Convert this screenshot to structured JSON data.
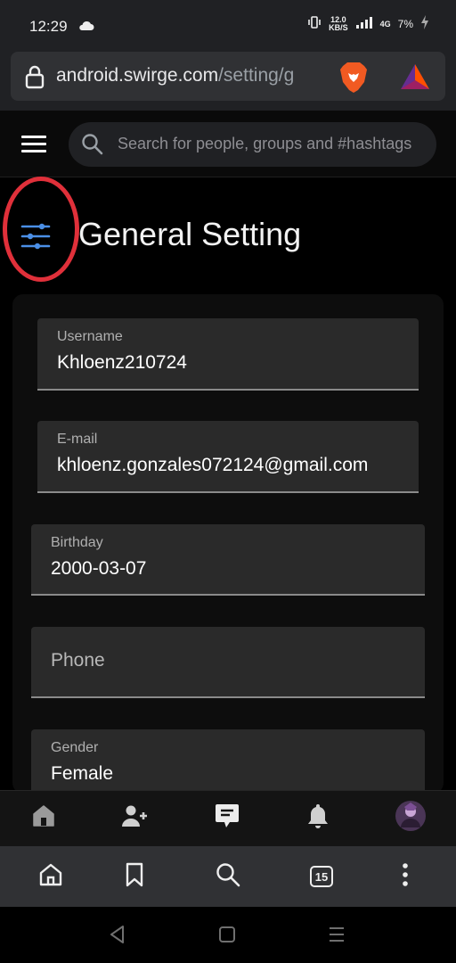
{
  "status_bar": {
    "time": "12:29",
    "speed_value": "12.0",
    "speed_unit": "KB/S",
    "network": "4G",
    "battery": "7%",
    "icons": [
      "cloud-icon",
      "vibrate-icon",
      "signal-icon",
      "battery-charging-icon"
    ]
  },
  "browser": {
    "url_domain": "android.swirge.com",
    "url_path": "/setting/g",
    "tab_count": "15",
    "icons": [
      "lock-icon",
      "brave-lion-icon",
      "bat-rewards-icon",
      "home-icon",
      "bookmark-icon",
      "search-icon",
      "more-vertical-icon"
    ]
  },
  "header": {
    "search_placeholder": "Search for people, groups and #hashtags",
    "icons": [
      "hamburger-menu-icon",
      "search-icon"
    ]
  },
  "page": {
    "title": "General Setting",
    "settings_icon": "sliders-icon"
  },
  "form": {
    "username": {
      "label": "Username",
      "value": "Khloenz210724"
    },
    "email": {
      "label": "E-mail",
      "value": "khloenz.gonzales072124@gmail.com"
    },
    "birthday": {
      "label": "Birthday",
      "value": "2000-03-07"
    },
    "phone": {
      "placeholder": "Phone"
    },
    "gender": {
      "label": "Gender",
      "value": "Female"
    }
  },
  "app_nav": {
    "icons": [
      "home-icon",
      "add-user-icon",
      "messages-icon",
      "bell-icon",
      "avatar"
    ]
  },
  "system_nav": {
    "icons": [
      "back-icon",
      "home-square-icon",
      "recents-icon"
    ]
  },
  "colors": {
    "accent_blue": "#4b8fe6",
    "highlight_red": "#e0303a",
    "field_bg": "#2a2a2a",
    "brave_orange": "#f15a22"
  }
}
